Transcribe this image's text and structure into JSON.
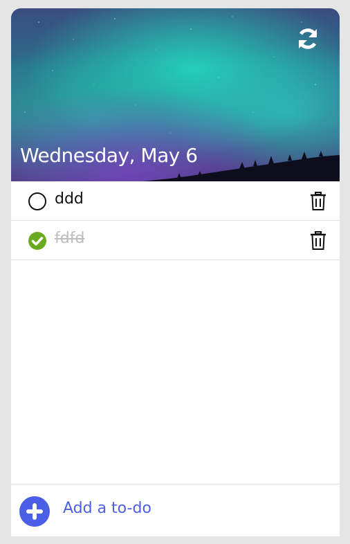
{
  "header": {
    "date": "Wednesday, May 6",
    "refresh_icon": "refresh-icon"
  },
  "todos": [
    {
      "text": "ddd",
      "done": false
    },
    {
      "text": "fdfd",
      "done": true
    }
  ],
  "footer": {
    "add_label": "Add a to-do",
    "add_icon": "plus-circle-icon"
  },
  "colors": {
    "accent": "#4a5fe6",
    "done_check": "#6aaa1e",
    "background": "#e5e5e5"
  }
}
